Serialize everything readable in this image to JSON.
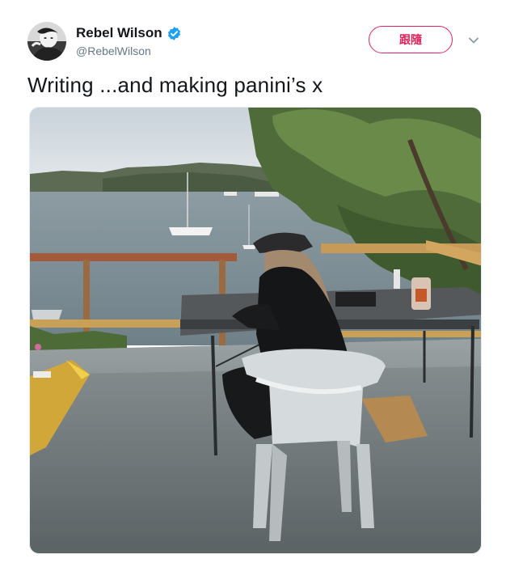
{
  "tweet": {
    "author": {
      "display_name": "Rebel Wilson",
      "handle": "@RebelWilson",
      "verified": true,
      "avatar_icon": "profile-avatar"
    },
    "follow_button_label": "跟隨",
    "menu_icon": "chevron-down-icon",
    "text": "Writing ...and making panini’s x",
    "media": {
      "description_icon": "photo"
    }
  },
  "colors": {
    "follow_accent": "#e0245e",
    "verified_blue": "#1da1f2",
    "handle_gray": "#657786",
    "text_dark": "#14171a"
  }
}
